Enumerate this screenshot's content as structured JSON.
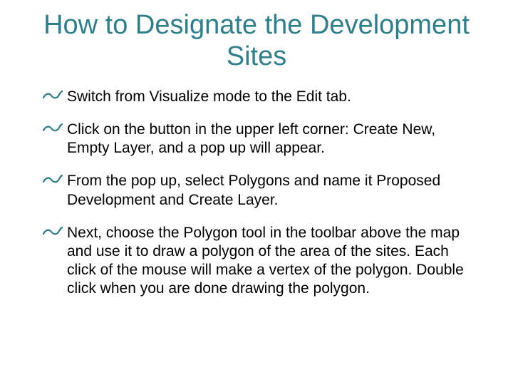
{
  "title": "How to Designate the Development Sites",
  "bullets": [
    "Switch from Visualize mode to the Edit tab.",
    "Click on the button in the upper left corner: Create New, Empty Layer, and a pop up will appear.",
    "From the pop up, select Polygons and name it Proposed Development and Create Layer.",
    "Next, choose the Polygon tool in the toolbar above the map and use it to draw a polygon of the area of the sites. Each click of the mouse will make a vertex of the polygon. Double click when you are done drawing the polygon."
  ]
}
